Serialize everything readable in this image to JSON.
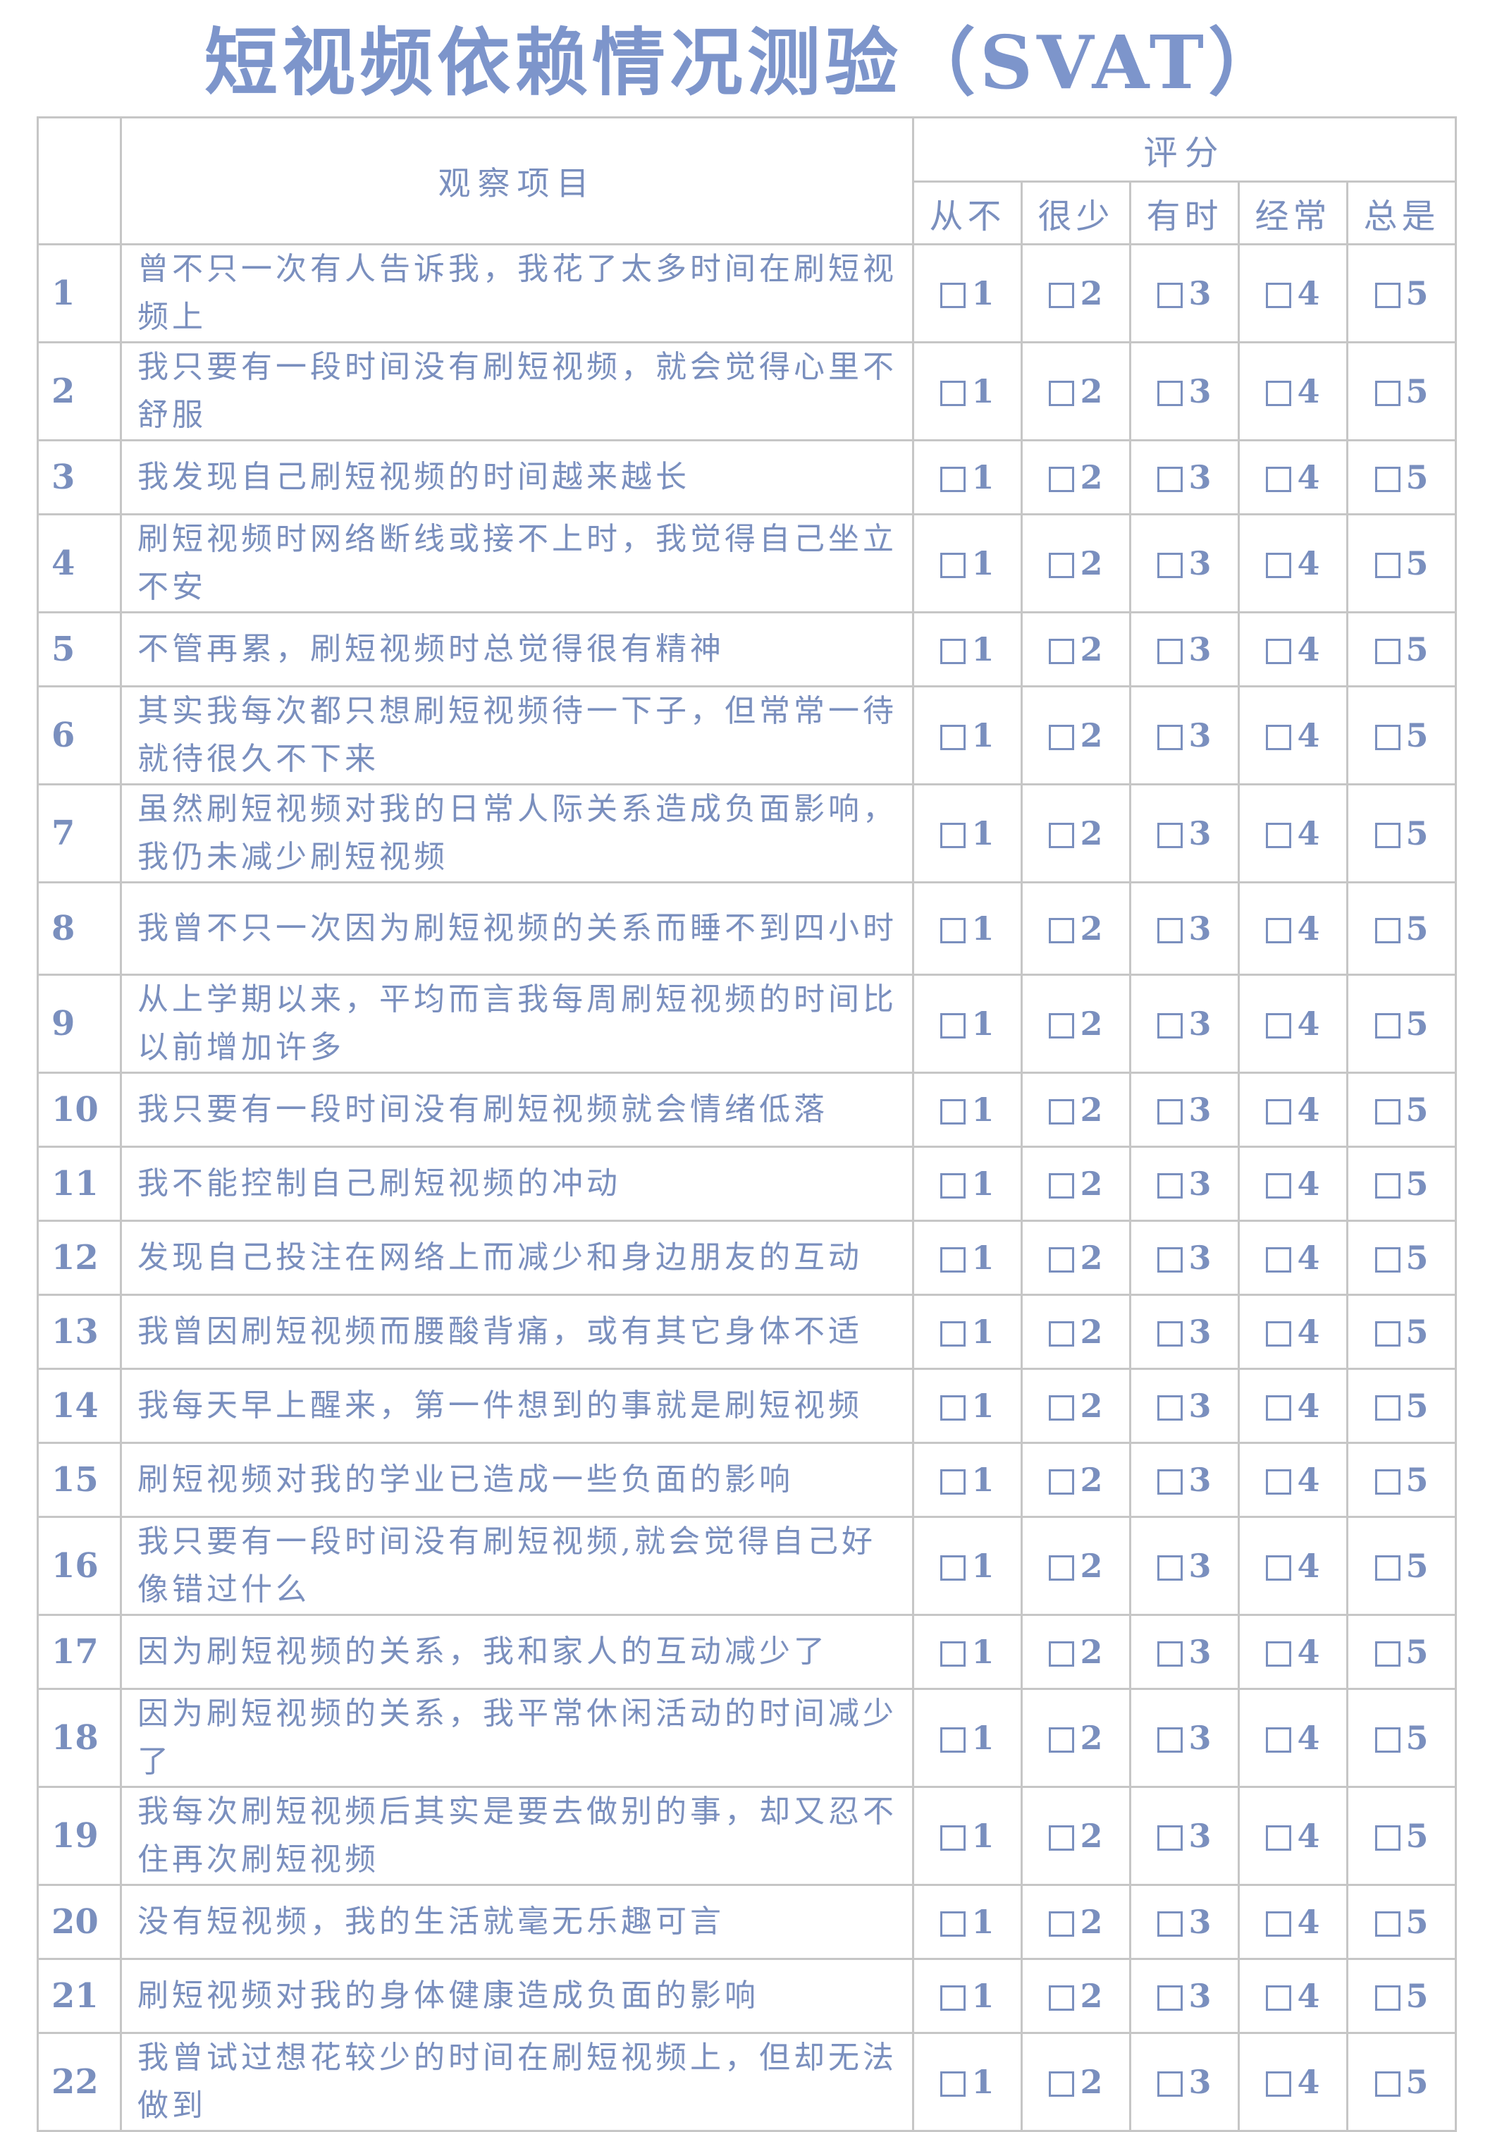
{
  "title": "短视频依赖情况测验（SVAT）",
  "header": {
    "item_label": "观察项目",
    "score_label": "评分",
    "options": [
      "从不",
      "很少",
      "有时",
      "经常",
      "总是"
    ]
  },
  "scores": [
    "1",
    "2",
    "3",
    "4",
    "5"
  ],
  "colors": {
    "text": "#7a8fbe",
    "title": "#7d95cb",
    "border": "#c6c6c6"
  },
  "items": [
    {
      "num": "1",
      "text": "曾不只一次有人告诉我，我花了太多时间在刷短视频上"
    },
    {
      "num": "2",
      "text": "我只要有一段时间没有刷短视频，就会觉得心里不舒服"
    },
    {
      "num": "3",
      "text": "我发现自己刷短视频的时间越来越长"
    },
    {
      "num": "4",
      "text": "刷短视频时网络断线或接不上时，我觉得自己坐立不安"
    },
    {
      "num": "5",
      "text": "不管再累，刷短视频时总觉得很有精神"
    },
    {
      "num": "6",
      "text": "其实我每次都只想刷短视频待一下子，但常常一待就待很久不下来"
    },
    {
      "num": "7",
      "text": "虽然刷短视频对我的日常人际关系造成负面影响，我仍未减少刷短视频"
    },
    {
      "num": "8",
      "text": "我曾不只一次因为刷短视频的关系而睡不到四小时"
    },
    {
      "num": "9",
      "text": "从上学期以来，平均而言我每周刷短视频的时间比以前增加许多"
    },
    {
      "num": "10",
      "text": "我只要有一段时间没有刷短视频就会情绪低落"
    },
    {
      "num": "11",
      "text": "我不能控制自己刷短视频的冲动"
    },
    {
      "num": "12",
      "text": "发现自己投注在网络上而减少和身边朋友的互动"
    },
    {
      "num": "13",
      "text": "我曾因刷短视频而腰酸背痛，或有其它身体不适"
    },
    {
      "num": "14",
      "text": "我每天早上醒来，第一件想到的事就是刷短视频"
    },
    {
      "num": "15",
      "text": "刷短视频对我的学业已造成一些负面的影响"
    },
    {
      "num": "16",
      "text": "我只要有一段时间没有刷短视频,就会觉得自己好像错过什么"
    },
    {
      "num": "17",
      "text": "因为刷短视频的关系，我和家人的互动减少了"
    },
    {
      "num": "18",
      "text": "因为刷短视频的关系，我平常休闲活动的时间减少了"
    },
    {
      "num": "19",
      "text": "我每次刷短视频后其实是要去做别的事，却又忍不住再次刷短视频"
    },
    {
      "num": "20",
      "text": "没有短视频，我的生活就毫无乐趣可言"
    },
    {
      "num": "21",
      "text": "刷短视频对我的身体健康造成负面的影响"
    },
    {
      "num": "22",
      "text": "我曾试过想花较少的时间在刷短视频上，但却无法做到"
    }
  ]
}
